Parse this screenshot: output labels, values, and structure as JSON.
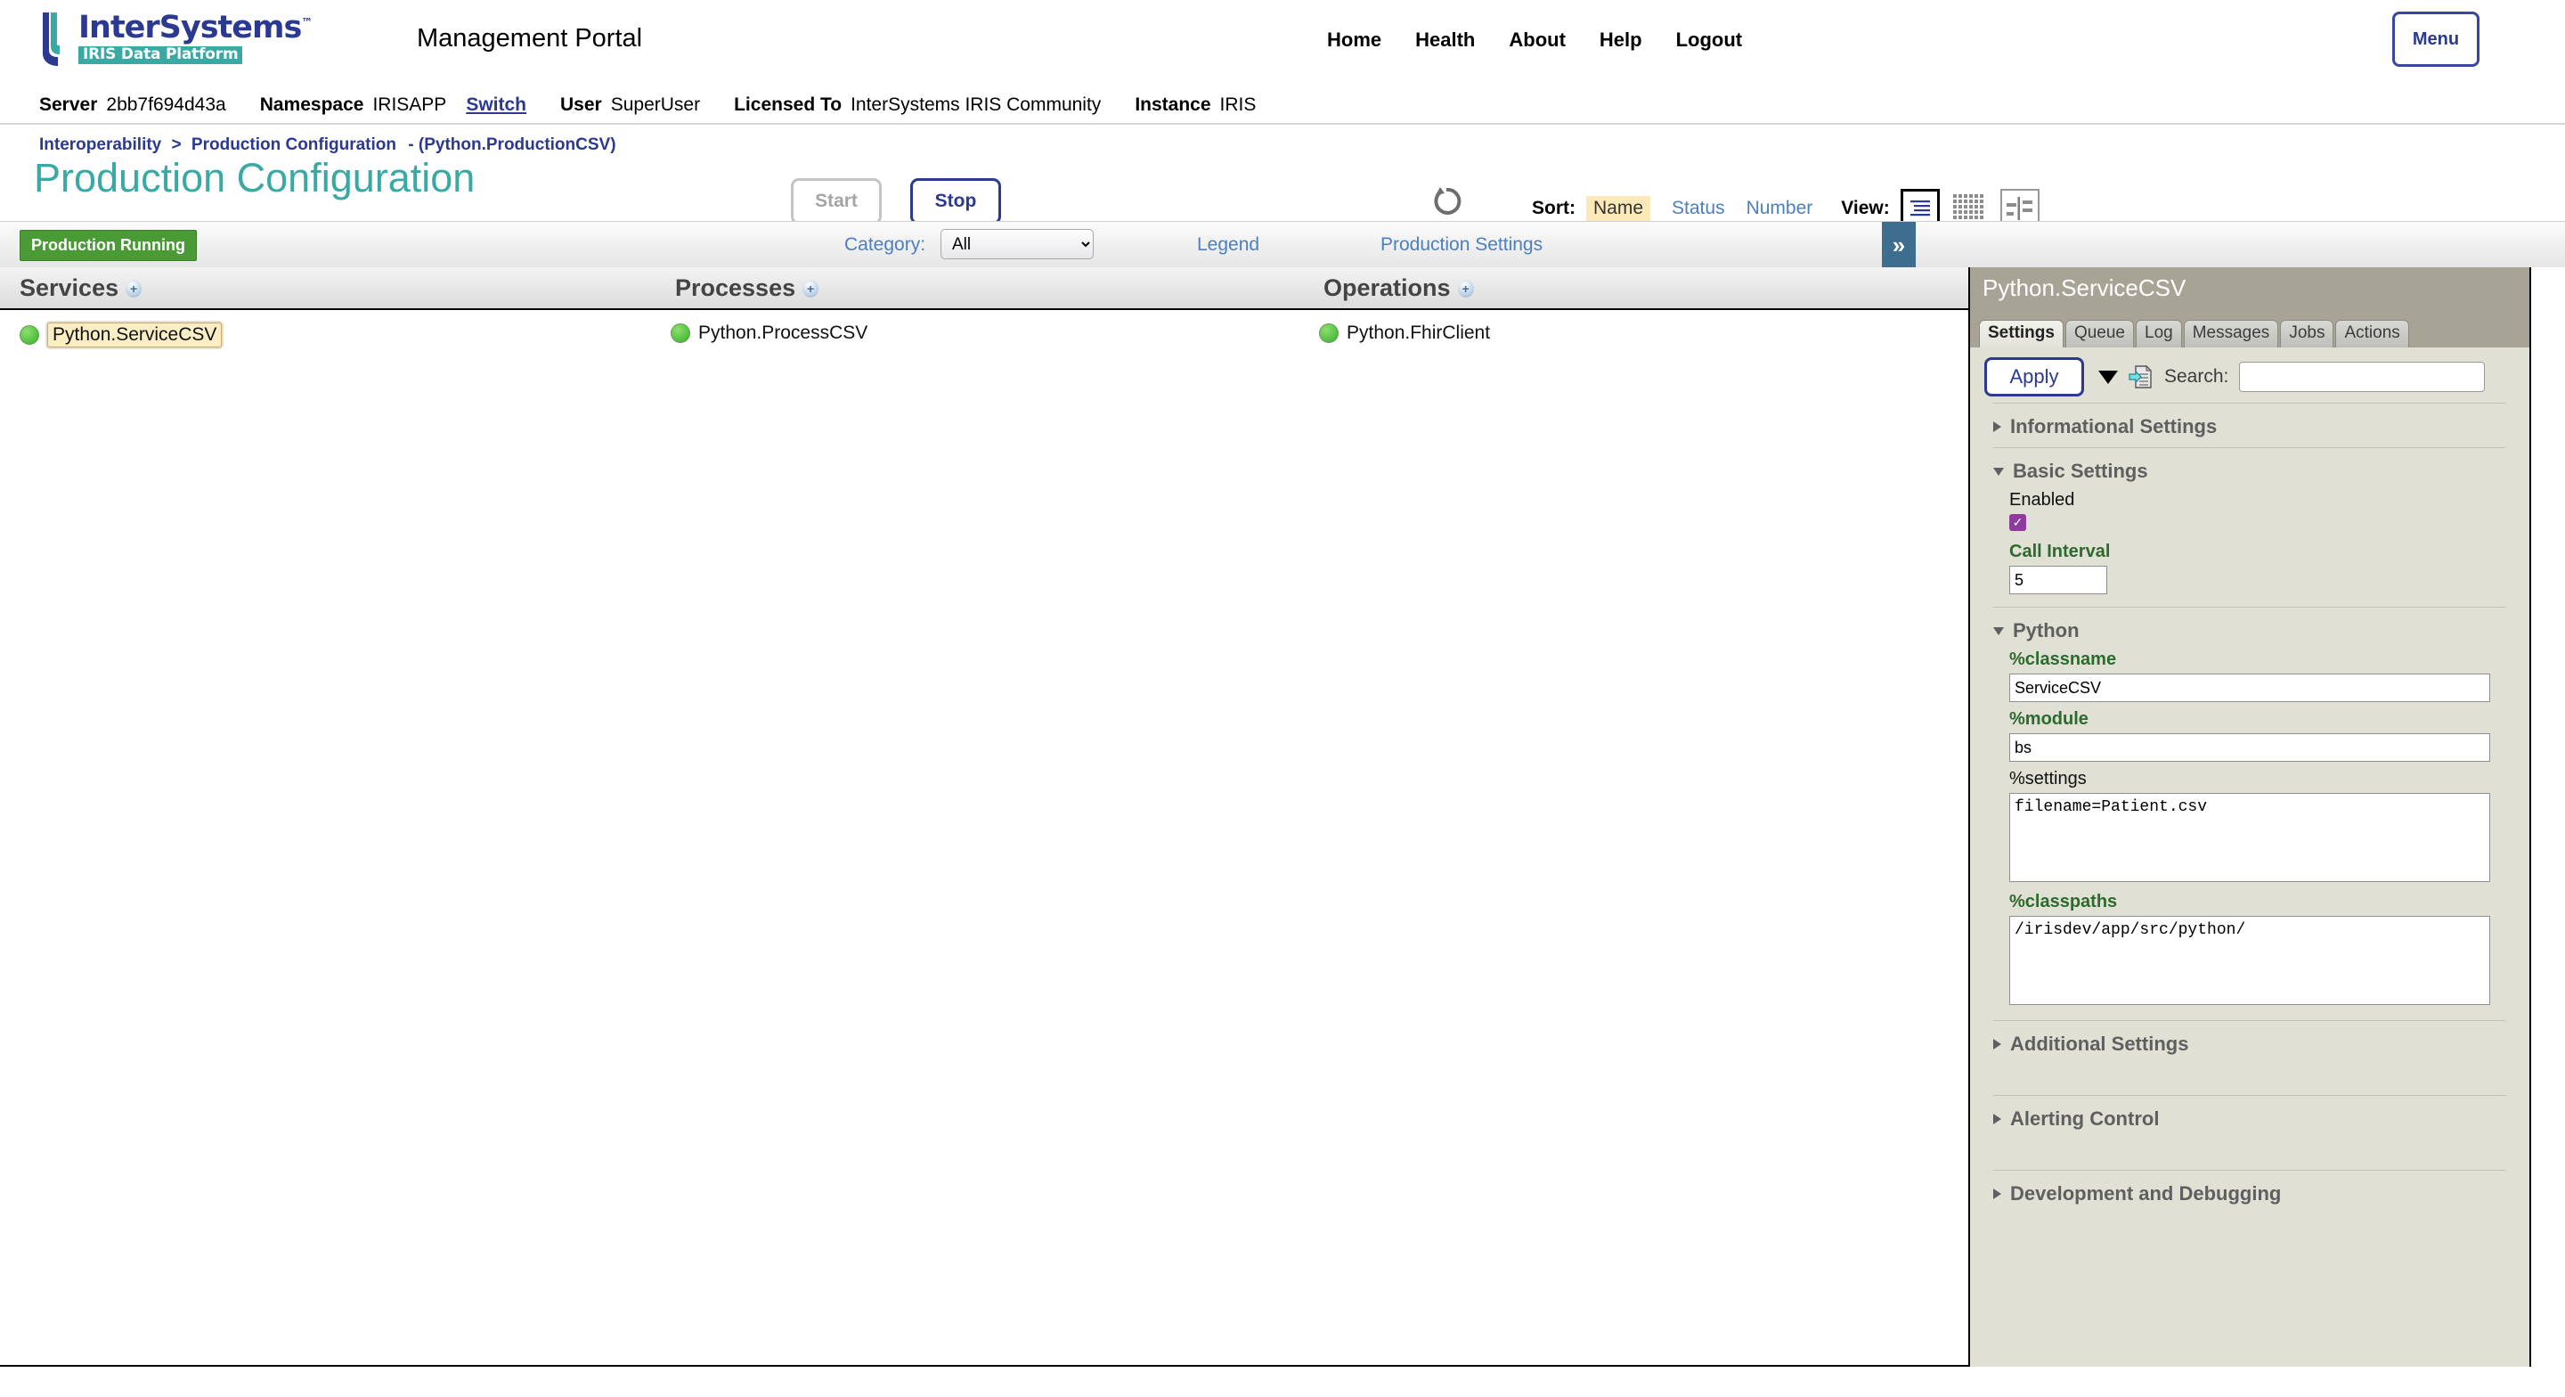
{
  "brand": {
    "name": "InterSystems",
    "tm": "™",
    "subtitle": "IRIS Data Platform"
  },
  "header": {
    "portal_title": "Management Portal",
    "nav": [
      {
        "label": "Home"
      },
      {
        "label": "Health"
      },
      {
        "label": "About"
      },
      {
        "label": "Help"
      },
      {
        "label": "Logout"
      }
    ],
    "menu_button": "Menu"
  },
  "infobar": {
    "server_label": "Server",
    "server_value": "2bb7f694d43a",
    "namespace_label": "Namespace",
    "namespace_value": "IRISAPP",
    "switch_link": "Switch",
    "user_label": "User",
    "user_value": "SuperUser",
    "licensed_label": "Licensed To",
    "licensed_value": "InterSystems IRIS Community",
    "instance_label": "Instance",
    "instance_value": "IRIS"
  },
  "breadcrumb": {
    "first": "Interoperability",
    "separator": ">",
    "second": "Production Configuration",
    "tail": "- (Python.ProductionCSV)"
  },
  "page": {
    "title": "Production Configuration"
  },
  "toolbar": {
    "start_label": "Start",
    "stop_label": "Stop",
    "refresh_icon": "refresh-icon",
    "sort_label": "Sort:",
    "sort_options": [
      {
        "label": "Name",
        "active": true
      },
      {
        "label": "Status",
        "active": false
      },
      {
        "label": "Number",
        "active": false
      }
    ],
    "view_label": "View:",
    "view_options": [
      {
        "icon": "list-view-icon",
        "selected": true
      },
      {
        "icon": "grid-view-icon",
        "selected": false
      },
      {
        "icon": "split-view-icon",
        "selected": false
      }
    ]
  },
  "catbar": {
    "production_status": "Production Running",
    "category_label": "Category:",
    "category_value": "All",
    "category_options": [
      "All"
    ],
    "legend_link": "Legend",
    "production_settings_link": "Production Settings",
    "expand_chevron": "»"
  },
  "columns": [
    {
      "title": "Services",
      "add_icon": "plus-icon",
      "items": [
        {
          "name": "Python.ServiceCSV",
          "status_color": "#4fbf3d",
          "selected": true
        }
      ]
    },
    {
      "title": "Processes",
      "add_icon": "plus-icon",
      "items": [
        {
          "name": "Python.ProcessCSV",
          "status_color": "#4fbf3d",
          "selected": false
        }
      ]
    },
    {
      "title": "Operations",
      "add_icon": "plus-icon",
      "items": [
        {
          "name": "Python.FhirClient",
          "status_color": "#4fbf3d",
          "selected": false
        }
      ]
    }
  ],
  "panel": {
    "title": "Python.ServiceCSV",
    "tabs": [
      {
        "label": "Settings",
        "active": true
      },
      {
        "label": "Queue",
        "active": false
      },
      {
        "label": "Log",
        "active": false
      },
      {
        "label": "Messages",
        "active": false
      },
      {
        "label": "Jobs",
        "active": false
      },
      {
        "label": "Actions",
        "active": false
      }
    ],
    "apply_label": "Apply",
    "dropdown_icon": "chevron-down-icon",
    "export_icon": "document-export-icon",
    "search_label": "Search:",
    "search_value": "",
    "search_placeholder": "",
    "sections": [
      {
        "id": "informational",
        "label": "Informational Settings",
        "expanded": false
      },
      {
        "id": "basic",
        "label": "Basic Settings",
        "expanded": true
      },
      {
        "id": "python",
        "label": "Python",
        "expanded": true
      },
      {
        "id": "additional",
        "label": "Additional Settings",
        "expanded": false
      },
      {
        "id": "alerting",
        "label": "Alerting Control",
        "expanded": false
      },
      {
        "id": "devdebug",
        "label": "Development and Debugging",
        "expanded": false
      }
    ],
    "basic_settings": {
      "enabled_label": "Enabled",
      "enabled_checked": true,
      "enabled_check_glyph": "✓",
      "call_interval_label": "Call Interval",
      "call_interval_value": "5"
    },
    "python_settings": {
      "classname_label": "%classname",
      "classname_value": "ServiceCSV",
      "module_label": "%module",
      "module_value": "bs",
      "settings_label": "%settings",
      "settings_value": "filename=Patient.csv",
      "classpaths_label": "%classpaths",
      "classpaths_value": "/irisdev/app/src/python/"
    }
  },
  "colors": {
    "brand_blue": "#2b3990",
    "brand_teal": "#3aa9a4",
    "link_blue": "#4a7fc1",
    "status_green": "#4a9a35",
    "panel_header": "#a8a495",
    "panel_body": "#e0e0d4",
    "highlight_yellow": "#fbe9b7",
    "checkbox_purple": "#8e3a9e",
    "label_green": "#2d6a2d"
  }
}
